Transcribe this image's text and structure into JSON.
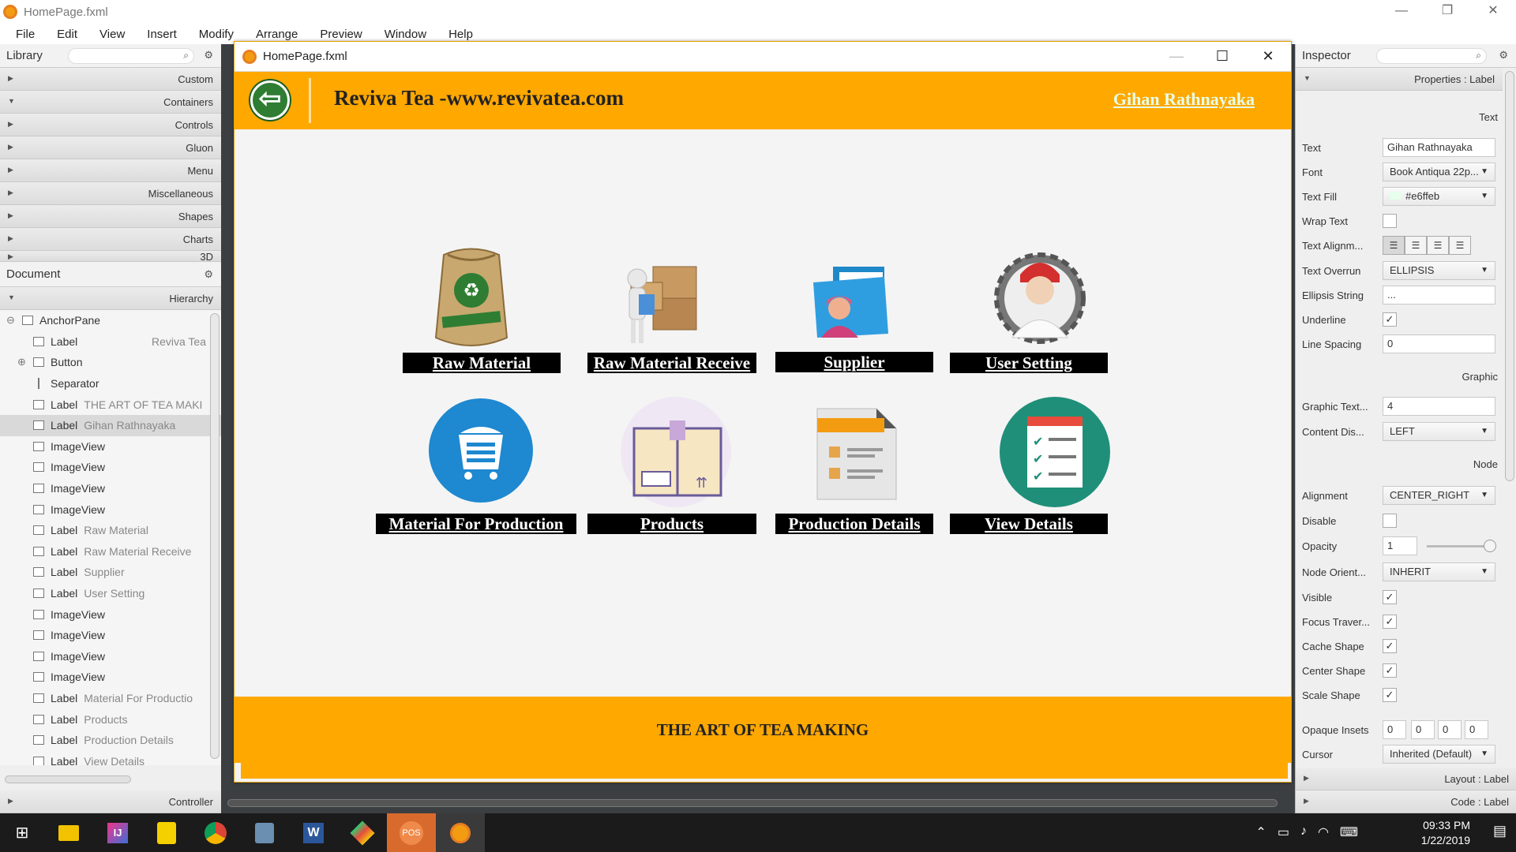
{
  "app": {
    "title": "HomePage.fxml"
  },
  "menu": [
    "File",
    "Edit",
    "View",
    "Insert",
    "Modify",
    "Arrange",
    "Preview",
    "Window",
    "Help"
  ],
  "library": {
    "title": "Library",
    "categories": [
      "Custom",
      "Containers",
      "Controls",
      "Gluon",
      "Menu",
      "Miscellaneous",
      "Shapes",
      "Charts",
      "3D"
    ]
  },
  "document": {
    "title": "Document",
    "tab": "Hierarchy",
    "rows": [
      {
        "type": "AnchorPane",
        "value": ""
      },
      {
        "type": "Label",
        "value": "Reviva Tea"
      },
      {
        "type": "Button",
        "value": ""
      },
      {
        "type": "Separator",
        "value": ""
      },
      {
        "type": "Label",
        "value": "THE ART OF TEA MAKI"
      },
      {
        "type": "Label",
        "value": "Gihan Rathnayaka"
      },
      {
        "type": "ImageView",
        "value": ""
      },
      {
        "type": "ImageView",
        "value": ""
      },
      {
        "type": "ImageView",
        "value": ""
      },
      {
        "type": "ImageView",
        "value": ""
      },
      {
        "type": "Label",
        "value": "Raw Material"
      },
      {
        "type": "Label",
        "value": "Raw Material Receive"
      },
      {
        "type": "Label",
        "value": "Supplier"
      },
      {
        "type": "Label",
        "value": "User Setting"
      },
      {
        "type": "ImageView",
        "value": ""
      },
      {
        "type": "ImageView",
        "value": ""
      },
      {
        "type": "ImageView",
        "value": ""
      },
      {
        "type": "ImageView",
        "value": ""
      },
      {
        "type": "Label",
        "value": "Material For Productio"
      },
      {
        "type": "Label",
        "value": "Products"
      },
      {
        "type": "Label",
        "value": "Production Details"
      },
      {
        "type": "Label",
        "value": "View Details"
      }
    ],
    "controller": "Controller"
  },
  "preview": {
    "window_title": "HomePage.fxml",
    "brand": "Reviva Tea -www.revivatea.com",
    "user": "Gihan Rathnayaka",
    "tiles": [
      {
        "label": "Raw Material",
        "icon": "raw-material-sack-icon"
      },
      {
        "label": "Raw Material Receive",
        "icon": "boxes-delivery-icon"
      },
      {
        "label": "Supplier",
        "icon": "supplier-folder-icon"
      },
      {
        "label": "User Setting",
        "icon": "user-gear-icon"
      },
      {
        "label": "Material For Production",
        "icon": "cart-icon"
      },
      {
        "label": "Products",
        "icon": "product-box-icon"
      },
      {
        "label": "Production Details",
        "icon": "document-icon"
      },
      {
        "label": "View Details",
        "icon": "checklist-icon"
      }
    ],
    "footer": "THE ART OF TEA MAKING"
  },
  "inspector": {
    "title": "Inspector",
    "properties_header": "Properties : Label",
    "sections": {
      "text": "Text",
      "graphic": "Graphic",
      "node": "Node"
    },
    "props": {
      "text": {
        "label": "Text",
        "value": "Gihan Rathnayaka"
      },
      "font": {
        "label": "Font",
        "value": "Book Antiqua 22p..."
      },
      "text_fill": {
        "label": "Text Fill",
        "value": "#e6ffeb"
      },
      "wrap_text": {
        "label": "Wrap Text"
      },
      "text_alignment": {
        "label": "Text Alignm..."
      },
      "text_overrun": {
        "label": "Text Overrun",
        "value": "ELLIPSIS"
      },
      "ellipsis_string": {
        "label": "Ellipsis String",
        "value": "..."
      },
      "underline": {
        "label": "Underline"
      },
      "line_spacing": {
        "label": "Line Spacing",
        "value": "0"
      },
      "graphic_text_gap": {
        "label": "Graphic Text...",
        "value": "4"
      },
      "content_display": {
        "label": "Content Dis...",
        "value": "LEFT"
      },
      "alignment": {
        "label": "Alignment",
        "value": "CENTER_RIGHT"
      },
      "disable": {
        "label": "Disable"
      },
      "opacity": {
        "label": "Opacity",
        "value": "1"
      },
      "node_orientation": {
        "label": "Node Orient...",
        "value": "INHERIT"
      },
      "visible": {
        "label": "Visible"
      },
      "focus_traversable": {
        "label": "Focus Traver..."
      },
      "cache_shape": {
        "label": "Cache Shape"
      },
      "center_shape": {
        "label": "Center Shape"
      },
      "scale_shape": {
        "label": "Scale Shape"
      },
      "opaque_insets": {
        "label": "Opaque Insets",
        "values": [
          "0",
          "0",
          "0",
          "0"
        ]
      },
      "cursor": {
        "label": "Cursor",
        "value": "Inherited (Default)"
      }
    },
    "layout_header": "Layout : Label",
    "code_header": "Code : Label"
  },
  "taskbar": {
    "time": "09:33 PM",
    "date": "1/22/2019",
    "pos_label": "POS"
  },
  "colors": {
    "accent": "#ffa800",
    "text_fill": "#e6ffeb",
    "back_button": "#2e7d32"
  }
}
